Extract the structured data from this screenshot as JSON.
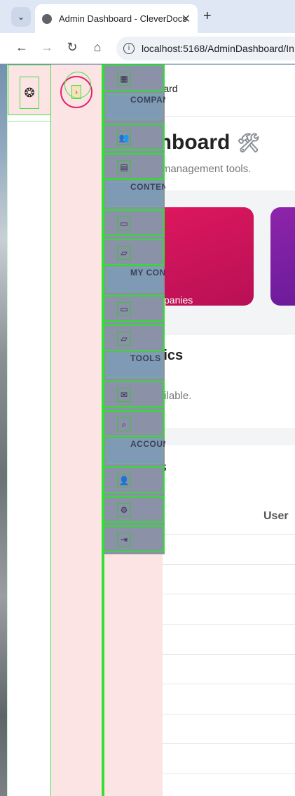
{
  "browser": {
    "tab_title": "Admin Dashboard - CleverDocs",
    "tab_close": "✕",
    "new_tab": "+",
    "url": "localhost:5168/AdminDashboard/In"
  },
  "main": {
    "breadcrumb": "hboard",
    "title": "shboard",
    "title_icon": "🛠",
    "subtitle": "nd management tools.",
    "stat_cards": [
      {
        "label": "panies",
        "color": "#c8155a"
      },
      {
        "label": "",
        "color": "#7b1fa2"
      }
    ],
    "statistics": {
      "title": "istics",
      "note": "available."
    },
    "activities": {
      "title": "ies",
      "column_user": "User"
    }
  },
  "sidebar": {
    "sections": [
      {
        "header": "COMPANIES",
        "items": [
          "dashboard-icon"
        ]
      },
      {
        "header": "CONTENT",
        "items": [
          "users-icon",
          "building-icon"
        ]
      },
      {
        "header": "MY CONTENT",
        "items": [
          "document-icon",
          "folder-icon"
        ]
      },
      {
        "header": "TOOLS",
        "items": [
          "document-icon",
          "folder-icon"
        ]
      },
      {
        "header": "ACCOUNT",
        "items": [
          "chat-icon",
          "search-icon"
        ]
      }
    ],
    "header_labels": [
      "COMPAN",
      "CONTEN",
      "MY CONT",
      "TOOLS",
      "ACCOUN"
    ]
  }
}
